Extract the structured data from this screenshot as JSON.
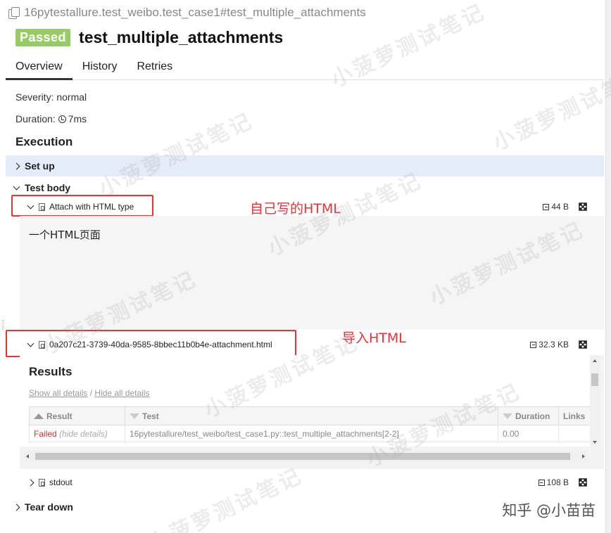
{
  "breadcrumb": "16pytestallure.test_weibo.test_case1#test_multiple_attachments",
  "status_badge": "Passed",
  "title": "test_multiple_attachments",
  "tabs": [
    "Overview",
    "History",
    "Retries"
  ],
  "severity": "Severity: normal",
  "duration": "Duration: ",
  "duration_value": "7ms",
  "execution_title": "Execution",
  "setup_label": "Set up",
  "test_body_label": "Test body",
  "attachments": [
    {
      "name": "Attach with HTML type",
      "size": "44 B"
    },
    {
      "name": "0a207c21-3739-40da-9585-8bbec11b0b4e-attachment.html",
      "size": "32.3 KB"
    },
    {
      "name": "stdout",
      "size": "108 B"
    }
  ],
  "annotations": {
    "first": "自己写的HTML",
    "second": "导入HTML"
  },
  "html_content": "一个HTML页面",
  "report": {
    "title": "Results",
    "show_all": "Show all details",
    "separator": " / ",
    "hide_all": "Hide all details",
    "columns": [
      "Result",
      "Test",
      "Duration",
      "Links"
    ],
    "rows": [
      {
        "result": "Failed",
        "hide": "(hide details)",
        "test": "16pytestallure/test_weibo/test_case1.py::test_multiple_attachments[2-2]",
        "duration": "0.00",
        "links": ""
      }
    ]
  },
  "teardown_label": "Tear down",
  "watermark": "小菠萝测试笔记",
  "zhihu_credit": "知乎 @小苗苗",
  "colors": {
    "passed": "#97cc64",
    "annotation": "#e5343a",
    "setup_bg": "#e3ecf8",
    "failed": "#cc3333"
  }
}
